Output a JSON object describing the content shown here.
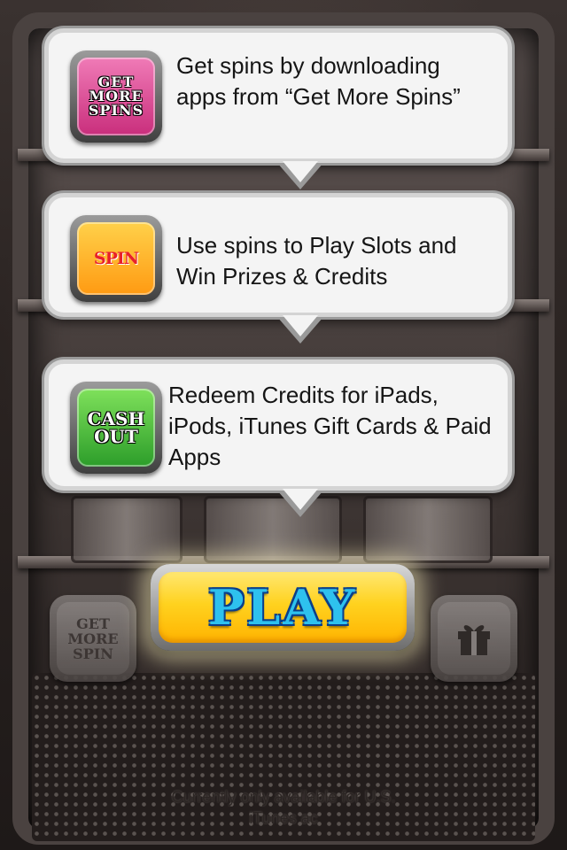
{
  "callouts": [
    {
      "icon_text": [
        "GET",
        "MORE",
        "SPINS"
      ],
      "icon_color": "#e0509a",
      "text": "Get spins by downloading apps from “Get More Spins”"
    },
    {
      "icon_text": [
        "SPIN"
      ],
      "icon_color": "#ffb21a",
      "text": "Use spins to Play Slots and Win Prizes & Credits"
    },
    {
      "icon_text": [
        "CASH",
        "OUT"
      ],
      "icon_color": "#3bb034",
      "text": "Redeem Credits for iPads, iPods, iTunes Gift Cards & Paid Apps"
    }
  ],
  "buttons": {
    "play_label": "PLAY",
    "get_more_spins": [
      "GET",
      "MORE",
      "SPIN"
    ],
    "gift_icon": "gift-icon"
  },
  "footer_lines": [
    "Currently only available for U.S.",
    "iTunes ac"
  ],
  "colors": {
    "play_face": "#ffd21f",
    "play_text": "#2ec1ee",
    "callout_bg": "#f4f4f4"
  }
}
